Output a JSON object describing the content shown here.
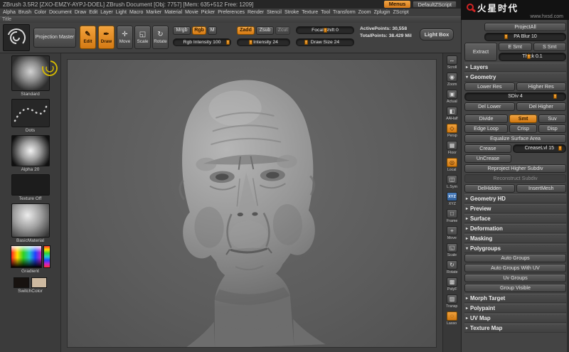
{
  "colors": {
    "accent_orange": "#e08a26",
    "accent_blue": "#3b6ba5",
    "logo_red": "#d22424",
    "canvas_gray": "#5c5c5c"
  },
  "titlebar": {
    "title": "ZBrush 3.5R2  [ZXO-EMZY-AYPJ-DOEL]    ZBrush Document   [Obj: 7757]  [Mem: 635+512 Free: 1209]",
    "menus": "Menus",
    "zscript": "DefaultZScript"
  },
  "menubar": [
    "Alpha",
    "Brush",
    "Color",
    "Document",
    "Draw",
    "Edit",
    "Layer",
    "Light",
    "Macro",
    "Marker",
    "Material",
    "Movie",
    "Picker",
    "Preferences",
    "Render",
    "Stencil",
    "Stroke",
    "Texture",
    "Tool",
    "Transform",
    "Zoom",
    "Zplugin",
    "ZScript"
  ],
  "title_row": "Title",
  "shelf": {
    "projection_master": "Projection Master",
    "edit": "Edit",
    "draw": "Draw",
    "move": "Move",
    "scale": "Scale",
    "rotate": "Rotate",
    "icons": {
      "edit": "✎",
      "draw": "✒",
      "move": "✛",
      "scale": "◱",
      "rotate": "↻"
    },
    "mrgb": "Mrgb",
    "rgb": "Rgb",
    "m": "M",
    "rgb_intensity": "Rgb Intensity 100",
    "zadd": "Zadd",
    "zsub": "Zsub",
    "zcut": "Zcut",
    "z_intensity": "Z Intensity 24",
    "focal_shift": "Focal Shift 0",
    "draw_size": "Draw Size 24",
    "active_points": "ActivePoints: 30,558",
    "total_points": "TotalPoints: 38.429 Mil",
    "light_box": "Light Box"
  },
  "sidebar": {
    "brush": "Standard",
    "stroke": "Dots",
    "alpha": "Alpha 20",
    "texture": "Texture Off",
    "material": "BasicMaterial",
    "gradient": "Gradient",
    "switch_color": "SwitchColor"
  },
  "right_strip": [
    {
      "label": "Scroll",
      "icon": "↔",
      "active": false,
      "badge": false
    },
    {
      "label": "Zoom",
      "icon": "◉",
      "active": false,
      "badge": false
    },
    {
      "label": "Actual",
      "icon": "▣",
      "active": false,
      "badge": false
    },
    {
      "label": "AAHalf",
      "icon": "◧",
      "active": false,
      "badge": false
    },
    {
      "label": "Persp",
      "icon": "◇",
      "active": true,
      "badge": false
    },
    {
      "label": "Floor",
      "icon": "▦",
      "active": false,
      "badge": false
    },
    {
      "label": "Local",
      "icon": "◎",
      "active": true,
      "badge": false
    },
    {
      "label": "L.Sym",
      "icon": "◫",
      "active": false,
      "badge": false
    },
    {
      "label": "XYZ",
      "icon": "XYZ",
      "active": false,
      "badge": true
    },
    {
      "label": "Frame",
      "icon": "□",
      "active": false,
      "badge": false
    },
    {
      "label": "Move",
      "icon": "+",
      "active": false,
      "badge": false
    },
    {
      "label": "Scale",
      "icon": "◱",
      "active": false,
      "badge": false
    },
    {
      "label": "Rotate",
      "icon": "↻",
      "active": false,
      "badge": false
    },
    {
      "label": "PolyF",
      "icon": "▩",
      "active": false,
      "badge": false
    },
    {
      "label": "Transp",
      "icon": "▨",
      "active": false,
      "badge": false
    },
    {
      "label": "Lasso",
      "icon": "◌",
      "active": true,
      "badge": false
    }
  ],
  "tool": {
    "project_all": "ProjectAll",
    "pa_blur": "PA Blur 10",
    "extract": "Extract",
    "e_smt": "E Smt",
    "s_smt": "S Smt",
    "thick": "Thick 0.1",
    "layers": "Layers",
    "geometry": "Geometry",
    "lower_res": "Lower Res",
    "higher_res": "Higher Res",
    "sdiv": "SDiv 4",
    "del_lower": "Del Lower",
    "del_higher": "Del Higher",
    "divide": "Divide",
    "smt": "Smt",
    "suv": "Suv",
    "edge_loop": "Edge Loop",
    "crisp": "Crisp",
    "disp": "Disp",
    "equalize": "Equalize Surface Area",
    "crease": "Crease",
    "crease_lvl": "CreaseLvl 15",
    "uncrease": "UnCrease",
    "reproject": "Reproject Higher Subdiv",
    "reconstruct": "Reconstruct Subdiv",
    "del_hidden": "DelHidden",
    "insert_mesh": "InsertMesh",
    "sections_mid": [
      "Geometry HD",
      "Preview",
      "Surface",
      "Deformation",
      "Masking"
    ],
    "polygroups": "Polygroups",
    "polygroup_buttons": [
      "Auto Groups",
      "Auto Groups With UV",
      "Uv Groups",
      "Group Visible"
    ],
    "sections_end": [
      "Morph Target",
      "Polypaint",
      "UV Map",
      "Texture Map"
    ]
  },
  "logo": {
    "brand": "火星时代",
    "site": "www.hxsd.com"
  }
}
